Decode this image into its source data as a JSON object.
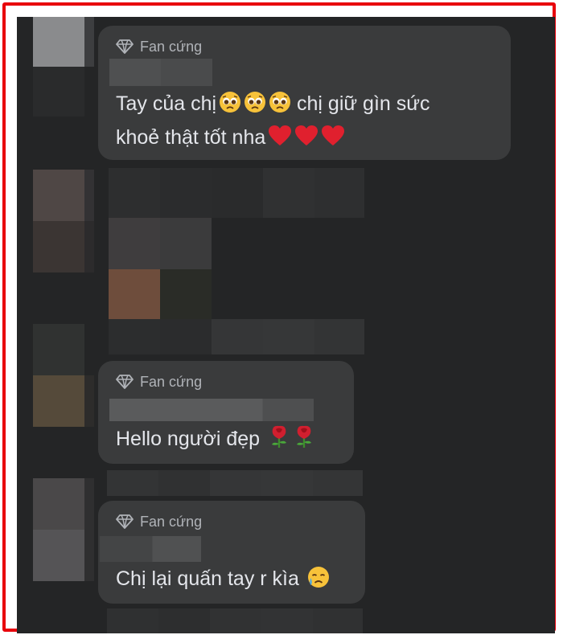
{
  "comments": [
    {
      "badge_label": "Fan cứng",
      "badge_icon": "diamond-icon",
      "text_line1": "Tay của chị",
      "text_line1_tail": "chị giữ gìn sức",
      "text_line2": "khoẻ thật tốt nha",
      "emojis_line1": [
        "sad-face-emoji",
        "sad-face-emoji",
        "sad-face-emoji"
      ],
      "emojis_line2": [
        "red-heart-emoji",
        "red-heart-emoji",
        "red-heart-emoji"
      ]
    },
    {
      "badge_label": "Fan cứng",
      "badge_icon": "diamond-icon",
      "text": "Hello người đẹp",
      "emojis": [
        "rose-emoji",
        "rose-emoji"
      ]
    },
    {
      "badge_label": "Fan cứng",
      "badge_icon": "diamond-icon",
      "text": "Chị lại quấn tay r kìa",
      "emojis": [
        "crying-face-emoji"
      ]
    }
  ],
  "colors": {
    "frame_border": "#e8000b",
    "panel_background": "#242526",
    "bubble_background": "#3a3b3c",
    "text_primary": "#e4e6eb",
    "text_secondary": "#b0b3b8"
  }
}
